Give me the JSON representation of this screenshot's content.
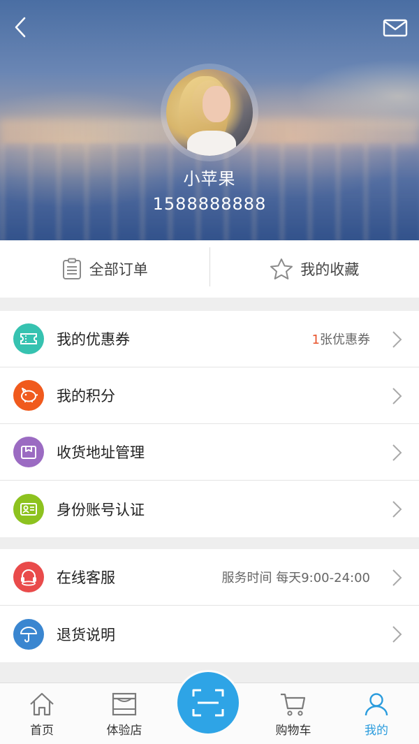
{
  "header": {
    "username": "小苹果",
    "phone": "1588888888"
  },
  "quick_tabs": [
    {
      "label": "全部订单",
      "icon": "clipboard-icon"
    },
    {
      "label": "我的收藏",
      "icon": "star-icon"
    }
  ],
  "menu_group_1": [
    {
      "label": "我的优惠券",
      "icon": "ticket-icon",
      "color": "#36c2b0",
      "extra_num": "1",
      "extra_text": "张优惠券"
    },
    {
      "label": "我的积分",
      "icon": "piggy-bank-icon",
      "color": "#f05a1d"
    },
    {
      "label": "收货地址管理",
      "icon": "package-icon",
      "color": "#9b6bc2"
    },
    {
      "label": "身份账号认证",
      "icon": "id-card-icon",
      "color": "#8dc21f"
    }
  ],
  "menu_group_2": [
    {
      "label": "在线客服",
      "icon": "headset-icon",
      "color": "#e94b4b",
      "extra_text": "服务时间  每天9:00-24:00"
    },
    {
      "label": "退货说明",
      "icon": "umbrella-icon",
      "color": "#3a86d0"
    }
  ],
  "tabbar": {
    "items": [
      {
        "label": "首页",
        "icon": "home-icon"
      },
      {
        "label": "体验店",
        "icon": "store-icon"
      },
      {
        "label": "购物车",
        "icon": "cart-icon"
      },
      {
        "label": "我的",
        "icon": "user-icon",
        "active": true
      }
    ],
    "scan_icon": "scan-icon",
    "accent": "#2b9cdd"
  }
}
